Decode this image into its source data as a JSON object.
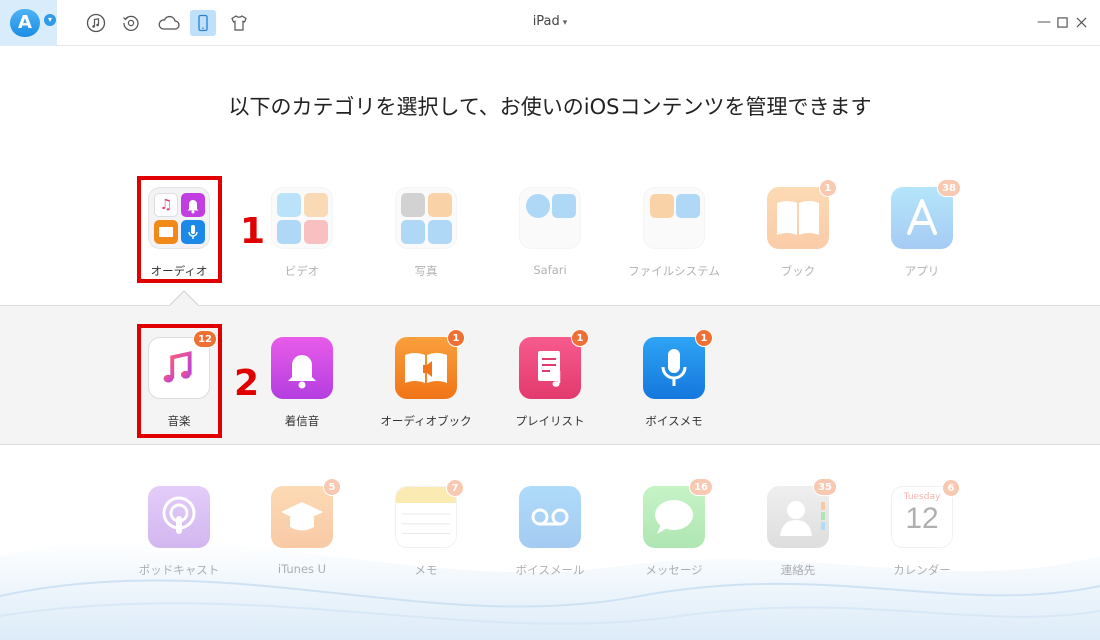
{
  "window": {
    "device_name": "iPad",
    "app_logo": "a-logo-icon"
  },
  "toolbar": {
    "items": [
      {
        "icon": "music-icon"
      },
      {
        "icon": "history-icon"
      },
      {
        "icon": "cloud-icon"
      },
      {
        "icon": "device-icon",
        "active": true
      },
      {
        "icon": "shirt-icon"
      }
    ]
  },
  "heading": "以下のカテゴリを選択して、お使いのiOSコンテンツを管理できます",
  "categories": [
    {
      "label": "オーディオ",
      "selected": true
    },
    {
      "label": "ビデオ"
    },
    {
      "label": "写真"
    },
    {
      "label": "Safari"
    },
    {
      "label": "ファイルシステム"
    },
    {
      "label": "ブック",
      "badge": "1"
    },
    {
      "label": "アプリ",
      "badge": "38"
    }
  ],
  "audio_items": [
    {
      "label": "音楽",
      "badge": "12"
    },
    {
      "label": "着信音"
    },
    {
      "label": "オーディオブック",
      "badge": "1"
    },
    {
      "label": "プレイリスト",
      "badge": "1"
    },
    {
      "label": "ボイスメモ",
      "badge": "1"
    }
  ],
  "other_items": [
    {
      "label": "ポッドキャスト"
    },
    {
      "label": "iTunes U",
      "badge": "5"
    },
    {
      "label": "メモ",
      "badge": "7"
    },
    {
      "label": "ボイスメール"
    },
    {
      "label": "メッセージ",
      "badge": "16"
    },
    {
      "label": "連絡先",
      "badge": "35"
    },
    {
      "label": "カレンダー",
      "badge": "6",
      "cal_month": "Tuesday",
      "cal_day": "12"
    }
  ],
  "steps": {
    "one": "1",
    "two": "2"
  },
  "colors": {
    "accent": "#1b8ee6",
    "badge": "#ef7034",
    "highlight": "#e00000"
  }
}
